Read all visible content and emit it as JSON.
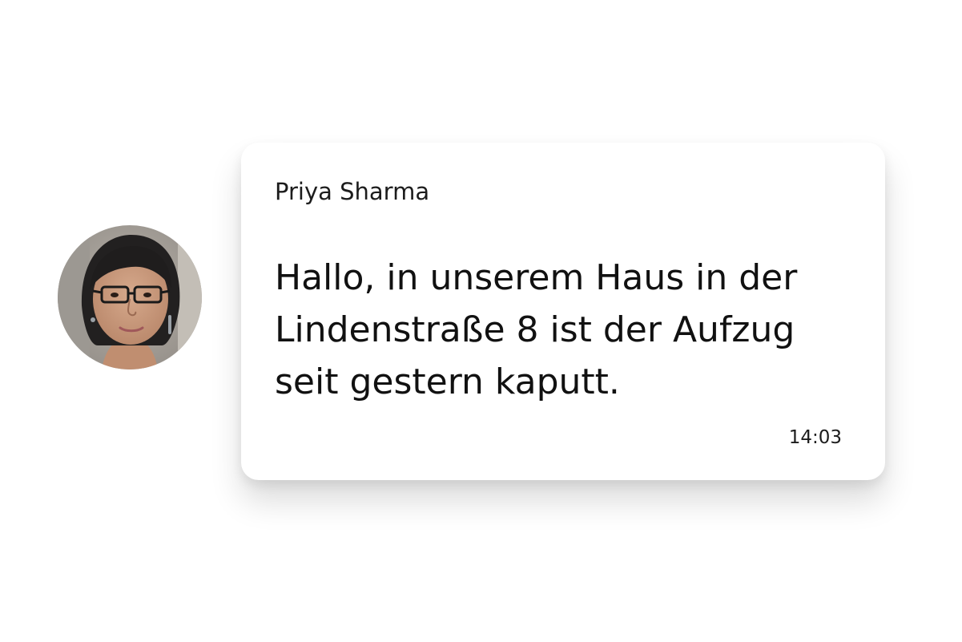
{
  "message": {
    "sender": "Priya Sharma",
    "text_lines": [
      "Hallo, in unserem Haus in der",
      "Lindenstraße 8 ist der Aufzug",
      "seit gestern kaputt."
    ],
    "time": "14:03"
  },
  "avatar": {
    "icon": "profile-photo"
  }
}
